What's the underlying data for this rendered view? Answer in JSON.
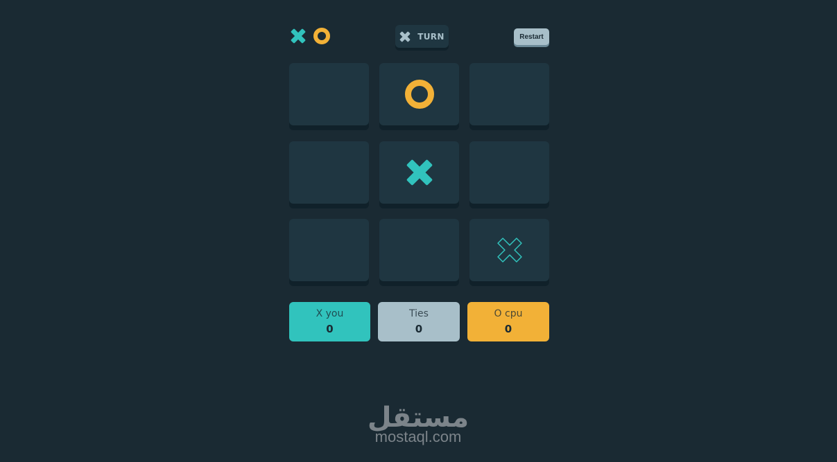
{
  "header": {
    "logo_icons": [
      "x-mark-icon",
      "o-mark-icon"
    ],
    "turn": {
      "icon": "x-mark-icon",
      "label": "TURN"
    },
    "restart_label": "Restart"
  },
  "board": {
    "cells": [
      {
        "row": 1,
        "col": 1,
        "mark": ""
      },
      {
        "row": 1,
        "col": 2,
        "mark": "O"
      },
      {
        "row": 1,
        "col": 3,
        "mark": ""
      },
      {
        "row": 2,
        "col": 1,
        "mark": ""
      },
      {
        "row": 2,
        "col": 2,
        "mark": "X"
      },
      {
        "row": 2,
        "col": 3,
        "mark": ""
      },
      {
        "row": 3,
        "col": 1,
        "mark": ""
      },
      {
        "row": 3,
        "col": 2,
        "mark": ""
      },
      {
        "row": 3,
        "col": 3,
        "mark": "X-hover-outline"
      }
    ]
  },
  "scores": {
    "x": {
      "label": "X you",
      "value": "0"
    },
    "ties": {
      "label": "Ties",
      "value": "0"
    },
    "o": {
      "label": "O cpu",
      "value": "0"
    }
  },
  "watermark": {
    "arabic": "مستقل",
    "latin": "mostaql.com"
  },
  "colors": {
    "background": "#1a2a33",
    "cell": "#1f3641",
    "cell_shadow": "#10212a",
    "x_teal": "#31c3bd",
    "o_yellow": "#f2b137",
    "silver": "#a8bfc9",
    "watermark": "#7c848a"
  }
}
